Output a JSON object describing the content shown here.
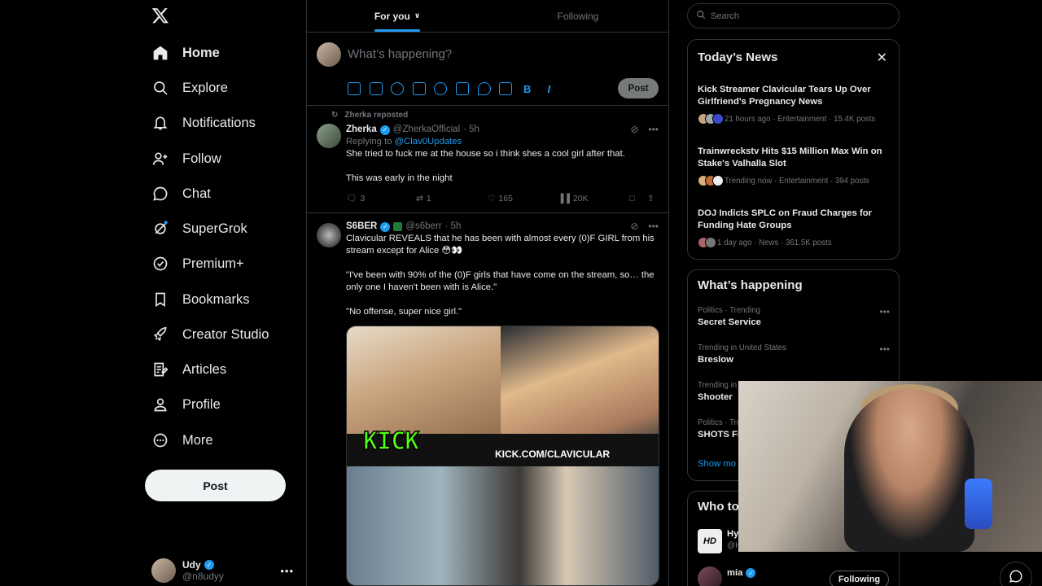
{
  "nav": {
    "items": [
      {
        "label": "Home",
        "icon": "home-icon",
        "active": true
      },
      {
        "label": "Explore",
        "icon": "search-icon"
      },
      {
        "label": "Notifications",
        "icon": "bell-icon"
      },
      {
        "label": "Follow",
        "icon": "person-add-icon"
      },
      {
        "label": "Chat",
        "icon": "chat-bubble-icon"
      },
      {
        "label": "SuperGrok",
        "icon": "grok-icon"
      },
      {
        "label": "Premium+",
        "icon": "premium-check-icon"
      },
      {
        "label": "Bookmarks",
        "icon": "bookmark-icon"
      },
      {
        "label": "Creator Studio",
        "icon": "rocket-icon"
      },
      {
        "label": "Articles",
        "icon": "article-icon"
      },
      {
        "label": "Profile",
        "icon": "person-icon"
      },
      {
        "label": "More",
        "icon": "more-circle-icon"
      }
    ],
    "post_label": "Post"
  },
  "account": {
    "name": "Udy",
    "handle": "@n8udyy"
  },
  "tabs": [
    {
      "label": "For you",
      "active": true
    },
    {
      "label": "Following",
      "active": false
    }
  ],
  "composer": {
    "placeholder": "What’s happening?",
    "post_label": "Post"
  },
  "tweets": [
    {
      "repost_label": "Zherka reposted",
      "name": "Zherka",
      "handle": "@ZherkaOfficial",
      "time": "· 5h",
      "reply_prefix": "Replying to",
      "reply_to": "@Clav0Updates",
      "text1": "She tried to fuck me at the house so i think shes a cool girl after that.",
      "text2": "This was early in the night",
      "replies": "3",
      "reposts": "1",
      "likes": "165",
      "views": "20K"
    },
    {
      "name": "S6BER",
      "handle": "@s6berr",
      "time": "· 5h",
      "text1": "Clavicular REVEALS that he has been with almost every (0)F GIRL from his stream except for Alice 😳👀",
      "text2": "\"I've been with 90% of the (0)F girls that have come on the stream, so… the only one I haven't been with is Alice.\"",
      "text3": "\"No offense, super nice girl.\"",
      "media_kick": "KICK",
      "media_url": "KICK.COM/CLAVICULAR"
    }
  ],
  "search": {
    "placeholder": "Search"
  },
  "todays_news": {
    "title": "Today’s News",
    "items": [
      {
        "headline": "Kick Streamer Clavicular Tears Up Over Girlfriend's Pregnancy News",
        "meta": "21 hours ago · Entertainment · 15.4K posts"
      },
      {
        "headline": "Trainwreckstv Hits $15 Million Max Win on Stake's Valhalla Slot",
        "meta": "Trending now · Entertainment · 394 posts"
      },
      {
        "headline": "DOJ Indicts SPLC on Fraud Charges for Funding Hate Groups",
        "meta": "1 day ago · News · 361.5K posts"
      }
    ]
  },
  "whats_happening": {
    "title": "What’s happening",
    "items": [
      {
        "category": "Politics · Trending",
        "topic": "Secret Service"
      },
      {
        "category": "Trending in United States",
        "topic": "Breslow"
      },
      {
        "category": "Trending in",
        "topic": "Shooter"
      },
      {
        "category": "Politics · Tre",
        "topic": "SHOTS FI"
      }
    ],
    "show_more": "Show mo"
  },
  "who_to_follow": {
    "title": "Who to",
    "items": [
      {
        "name": "Hy",
        "handle": "@H"
      },
      {
        "name": "mia",
        "handle": "@miamayer",
        "button": "Following"
      }
    ]
  },
  "colors": {
    "accent": "#1d9bf0",
    "background": "#000000",
    "border": "#2f3336",
    "muted": "#71767b",
    "kick_green": "#53fc18"
  }
}
